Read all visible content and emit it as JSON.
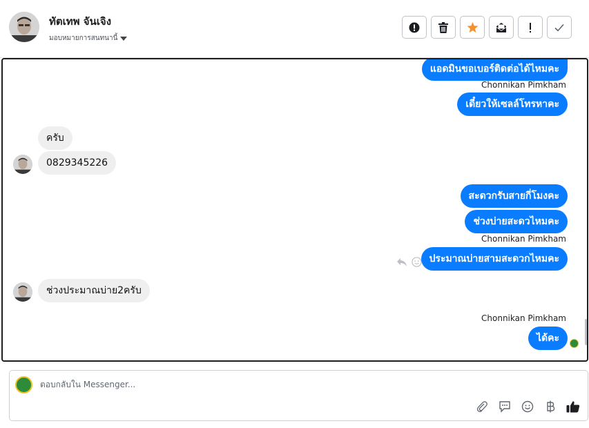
{
  "header": {
    "contact_name": "ทัตเทพ จันเจิง",
    "assign_label": "มอบหมายการสนทนานี้"
  },
  "toolbar": {
    "buttons": [
      "alert-circle-icon",
      "trash-icon",
      "star-icon",
      "mark-unread-icon",
      "exclamation-icon",
      "check-icon"
    ]
  },
  "thread": {
    "messages": [
      {
        "side": "out",
        "text": "แอดมินขอเบอร์ติดต่อได้ไหมคะ"
      },
      {
        "side": "out",
        "sender": "Chonnikan Pimkham",
        "text": "เดี๋ยวให้เซลล์โทรหาคะ"
      },
      {
        "side": "in",
        "text": "ครับ"
      },
      {
        "side": "in",
        "text": "0829345226"
      },
      {
        "side": "out",
        "text": "สะดวกรับสายกี่โมงคะ"
      },
      {
        "side": "out",
        "text": "ช่วงบ่ายสะดวไหมคะ"
      },
      {
        "side": "out",
        "sender": "Chonnikan Pimkham",
        "text": "ประมาณบ่ายสามสะดวกไหมคะ"
      },
      {
        "side": "in",
        "text": "ช่วงประมาณบ่าย2ครับ"
      },
      {
        "side": "out",
        "sender": "Chonnikan Pimkham",
        "text": "ได้คะ"
      }
    ]
  },
  "reply": {
    "placeholder": "ตอบกลับใน Messenger..."
  },
  "colors": {
    "outgoing_bubble": "#0a7cff",
    "incoming_bubble": "#efefef",
    "star": "#f5902a"
  }
}
